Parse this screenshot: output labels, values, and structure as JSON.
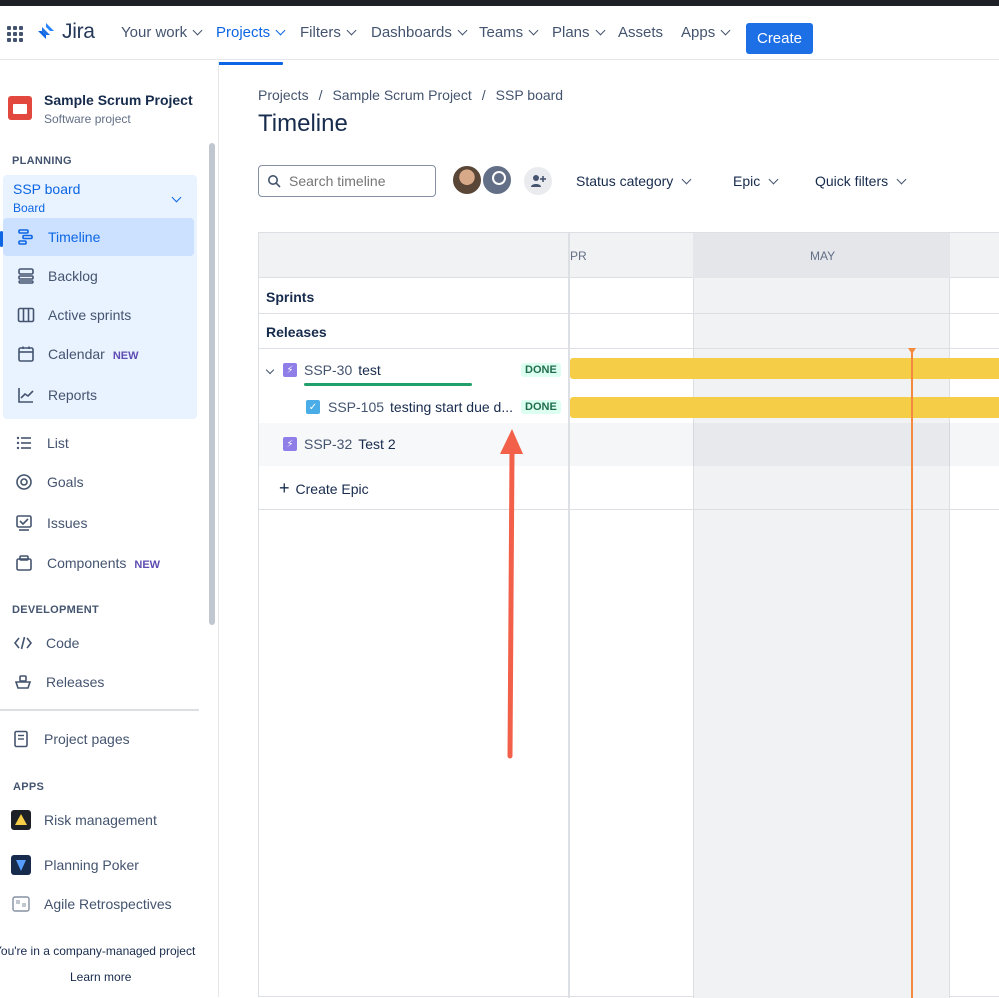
{
  "topnav": {
    "logo_text": "Jira",
    "items": [
      {
        "label": "Your work",
        "dropdown": true
      },
      {
        "label": "Projects",
        "dropdown": true,
        "active": true
      },
      {
        "label": "Filters",
        "dropdown": true
      },
      {
        "label": "Dashboards",
        "dropdown": true
      },
      {
        "label": "Teams",
        "dropdown": true
      },
      {
        "label": "Plans",
        "dropdown": true
      },
      {
        "label": "Assets",
        "dropdown": false
      },
      {
        "label": "Apps",
        "dropdown": true
      }
    ],
    "create_label": "Create",
    "accent": "#0c66e4"
  },
  "sidebar": {
    "project_name": "Sample Scrum Project",
    "project_type": "Software project",
    "planning_label": "PLANNING",
    "board_title": "SSP board",
    "board_sub": "Board",
    "planning_items": [
      {
        "label": "Timeline",
        "icon": "timeline-icon",
        "active": true
      },
      {
        "label": "Backlog",
        "icon": "backlog-icon"
      },
      {
        "label": "Active sprints",
        "icon": "columns-icon"
      },
      {
        "label": "Calendar",
        "icon": "calendar-icon",
        "badge": "NEW"
      },
      {
        "label": "Reports",
        "icon": "chart-line-icon"
      }
    ],
    "other_items": [
      {
        "label": "List",
        "icon": "list-icon"
      },
      {
        "label": "Goals",
        "icon": "target-icon"
      },
      {
        "label": "Issues",
        "icon": "issues-icon"
      },
      {
        "label": "Components",
        "icon": "component-icon",
        "badge": "NEW"
      }
    ],
    "development_label": "DEVELOPMENT",
    "development_items": [
      {
        "label": "Code",
        "icon": "code-icon"
      },
      {
        "label": "Releases",
        "icon": "ship-icon"
      }
    ],
    "project_pages_label": "Project pages",
    "apps_label": "APPS",
    "apps_items": [
      {
        "label": "Risk management",
        "icon": "risk-app-icon"
      },
      {
        "label": "Planning Poker",
        "icon": "poker-app-icon"
      },
      {
        "label": "Agile Retrospectives",
        "icon": "retro-app-icon"
      }
    ],
    "footer_text": "You're in a company-managed project",
    "learn_more": "Learn more"
  },
  "main": {
    "breadcrumb": [
      "Projects",
      "Sample Scrum Project",
      "SSP board"
    ],
    "breadcrumb_sep": "/",
    "title": "Timeline",
    "search_placeholder": "Search timeline",
    "filters": [
      "Status category",
      "Epic",
      "Quick filters"
    ],
    "months": [
      "PR",
      "MAY"
    ],
    "sprints_label": "Sprints",
    "releases_label": "Releases",
    "issues": [
      {
        "key": "SSP-30",
        "summary": "test",
        "status": "DONE",
        "type": "epic",
        "expanded": true,
        "progress": 1.0
      },
      {
        "key": "SSP-105",
        "summary": "testing start due d...",
        "status": "DONE",
        "type": "task"
      },
      {
        "key": "SSP-32",
        "summary": "Test 2",
        "status": "",
        "type": "epic"
      }
    ],
    "create_epic": "Create Epic",
    "bar_color": "#f5cd47",
    "today_color": "#f38a3f"
  }
}
